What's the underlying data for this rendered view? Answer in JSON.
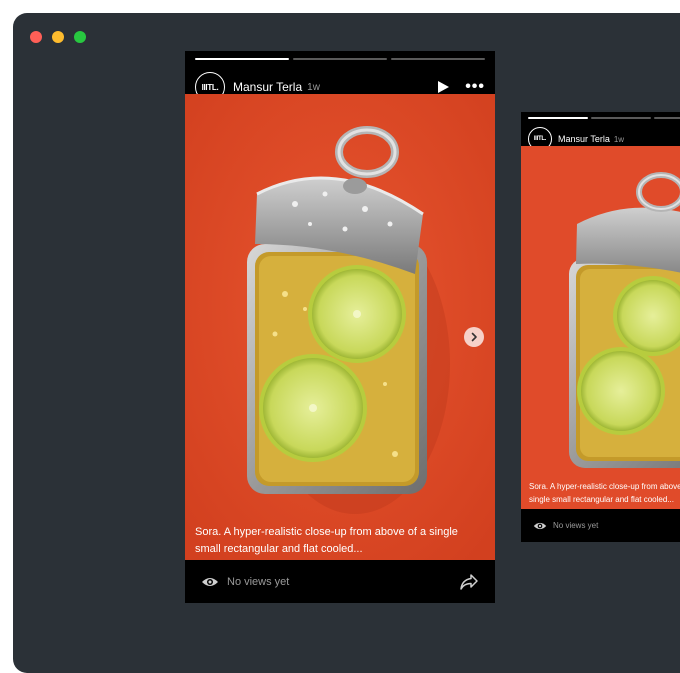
{
  "colors": {
    "window_bg": "#2b3137",
    "story_bg": "#000000",
    "media_bg": "#e04b2a"
  },
  "main_story": {
    "avatar_text": "IIITL.",
    "username": "Mansur Terla",
    "time": "1w",
    "caption": "Sora. A hyper-realistic close-up from above of a single small rectangular and flat cooled...",
    "views": "No views yet",
    "icons": [
      "play-icon",
      "more-icon",
      "chevron-right-icon",
      "eye-icon",
      "share-icon"
    ]
  },
  "side_story": {
    "avatar_text": "IIITL.",
    "username": "Mansur Terla",
    "time": "1w",
    "caption": "Sora. A hyper-realistic close-up from above of a single small rectangular and flat cooled...",
    "views": "No views yet"
  }
}
